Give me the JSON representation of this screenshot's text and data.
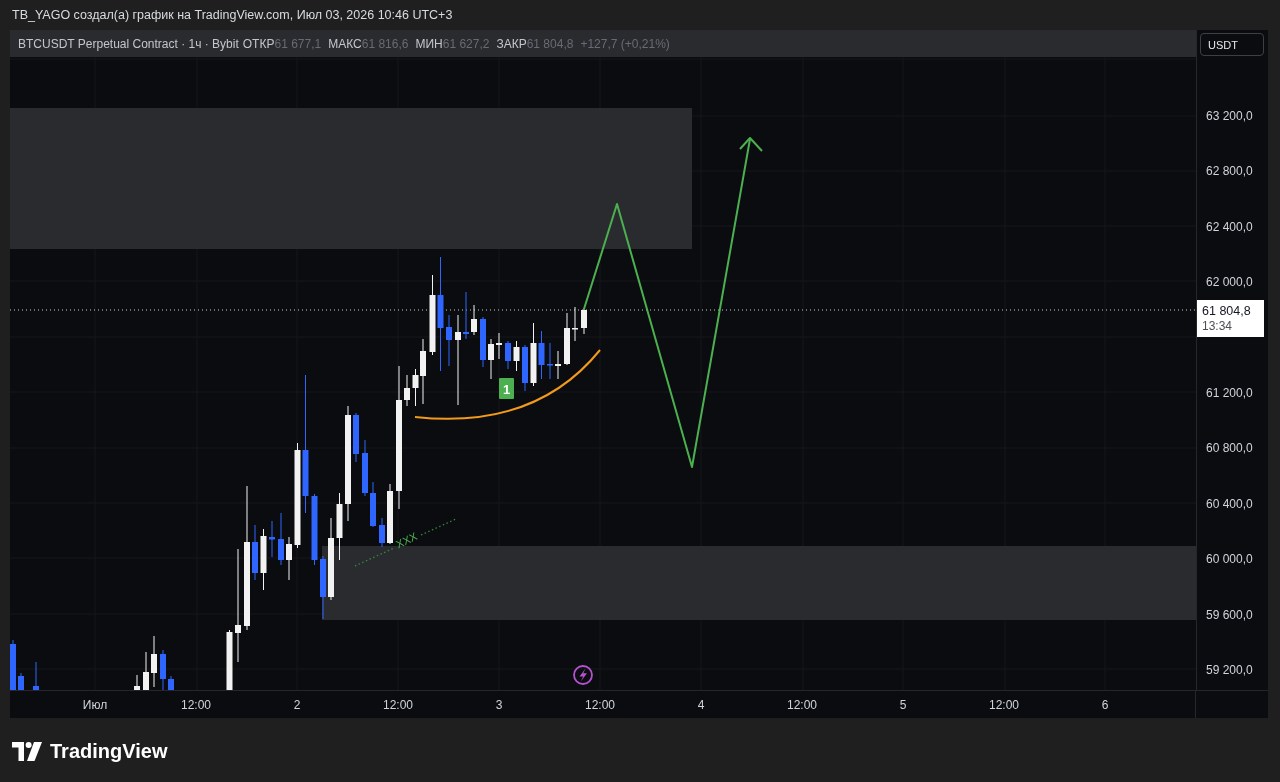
{
  "header": {
    "caption": "TB_YAGO создал(а) график на TradingView.com, Июл 03, 2026 10:46 UTC+3"
  },
  "legend": {
    "symbol": "BTCUSDT Perpetual Contract · 1ч · Bybit",
    "fields": [
      {
        "label": "ОТКР",
        "value": "61 677,1"
      },
      {
        "label": "МАКС",
        "value": "61 816,6"
      },
      {
        "label": "МИН",
        "value": "61 627,2"
      },
      {
        "label": "ЗАКР",
        "value": "61 804,8"
      }
    ],
    "change": "+127,7 (+0,21%)"
  },
  "chart": {
    "badge": "1",
    "trend_label": "XXX"
  },
  "price_axis": {
    "currency_button": "USDT",
    "labels": [
      "63 200,0",
      "62 800,0",
      "62 400,0",
      "62 000,0",
      "61 200,0",
      "60 800,0",
      "60 400,0",
      "60 000,0",
      "59 600,0",
      "59 200,0"
    ],
    "last_price": "61 804,8",
    "countdown": "13:34"
  },
  "time_axis": {
    "labels": [
      "Июл",
      "12:00",
      "2",
      "12:00",
      "3",
      "12:00",
      "4",
      "12:00",
      "5",
      "12:00",
      "6"
    ]
  },
  "footer": {
    "logo_text": "TradingView"
  }
}
